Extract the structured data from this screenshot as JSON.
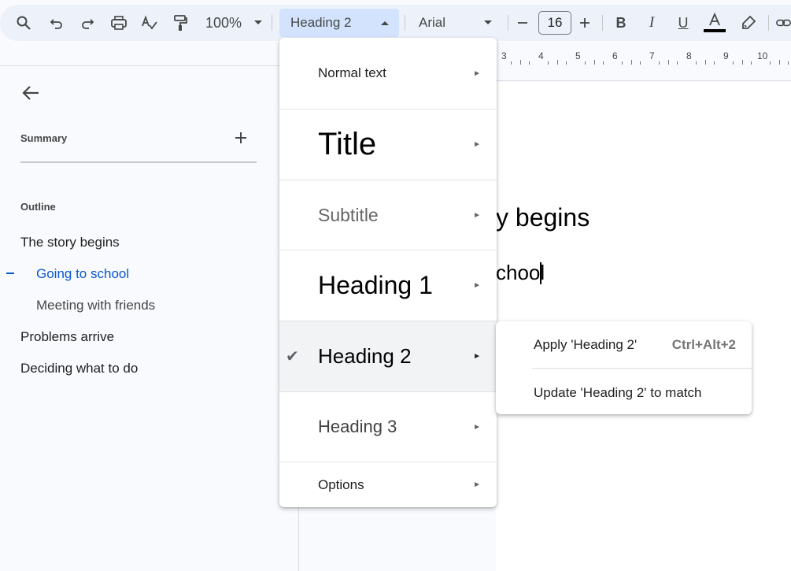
{
  "toolbar": {
    "zoom": "100%",
    "style_selected": "Heading 2",
    "font": "Arial",
    "font_size": "16",
    "icons": [
      "search-icon",
      "undo-icon",
      "redo-icon",
      "print-icon",
      "spellcheck-icon",
      "paint-format-icon",
      "decrease-size-icon",
      "increase-size-icon",
      "bold-icon",
      "italic-icon",
      "underline-icon",
      "text-color-icon",
      "highlight-icon",
      "link-icon"
    ],
    "text_color": "#000000"
  },
  "ruler": {
    "numbers": [
      "3",
      "4",
      "5",
      "6",
      "7",
      "8",
      "9",
      "10"
    ]
  },
  "sidebar": {
    "summary_label": "Summary",
    "outline_label": "Outline",
    "items": [
      {
        "label": "The story begins",
        "level": 1
      },
      {
        "label": "Going to school",
        "level": 2,
        "active": true
      },
      {
        "label": "Meeting with friends",
        "level": 2
      },
      {
        "label": "Problems arrive",
        "level": 1
      },
      {
        "label": "Deciding what to do",
        "level": 1
      }
    ]
  },
  "document": {
    "heading1_visible": "y begins",
    "heading2_visible": "chool"
  },
  "style_menu": {
    "items": [
      {
        "label": "Normal text"
      },
      {
        "label": "Title"
      },
      {
        "label": "Subtitle"
      },
      {
        "label": "Heading 1"
      },
      {
        "label": "Heading 2",
        "checked": true
      },
      {
        "label": "Heading 3"
      },
      {
        "label": "Options"
      }
    ],
    "arrow": "►",
    "check": "✔"
  },
  "submenu": {
    "apply_label": "Apply 'Heading 2'",
    "apply_shortcut": "Ctrl+Alt+2",
    "update_label": "Update 'Heading 2' to match"
  },
  "colors": {
    "accent": "#0b57d0",
    "selection_bg": "#d3e3fd",
    "toolbar_bg": "#edf2fa"
  }
}
